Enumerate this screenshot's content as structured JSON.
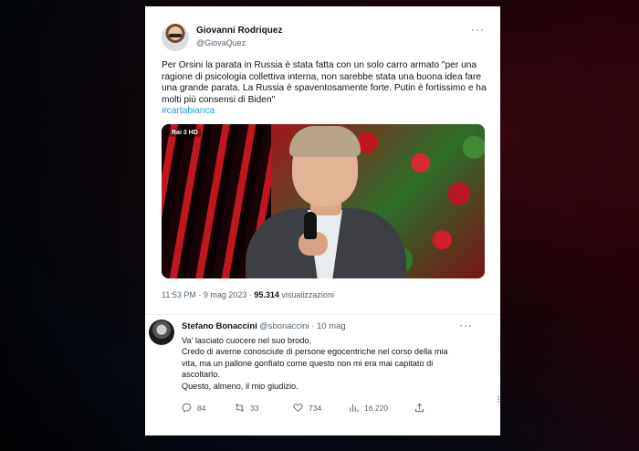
{
  "tweet": {
    "author_name": "Giovanni Rodriquez",
    "author_handle": "@GiovaQuez",
    "text": "Per Orsini la parata in Russia è stata fatta con un solo carro armato \"per una ragione di psicologia collettiva interna, non sarebbe stata una buona idea fare una grande parata. La Russia è spaventosamente forte. Putin è fortissimo e ha molti più consensi di Biden\"",
    "hashtag": "#cartabianca",
    "media_logo": "Rai 3 HD",
    "time": "11:53 PM · 9 mag 2023 · ",
    "views_count": "95.314",
    "views_label": " visualizzazioni",
    "more_icon": "more-horizontal-icon"
  },
  "reply": {
    "author_name": "Stefano Bonaccini",
    "author_handle": "@sbonaccini · 10 mag",
    "lines": [
      "Va' lasciato cuocere nel suo brodo.",
      "Credo di averne conosciute di persone egocentriche nel corso della mia",
      "vita, ma un pallone gonfiato come questo non mi era mai capitato di",
      "ascoltarlo.",
      "Questo, almeno, il mio giudizio."
    ],
    "actions": {
      "replies": "84",
      "retweets": "33",
      "likes": "734",
      "views": "16.220"
    }
  },
  "colors": {
    "link": "#1d9bf0",
    "text": "#0f1419",
    "muted": "#536471"
  }
}
